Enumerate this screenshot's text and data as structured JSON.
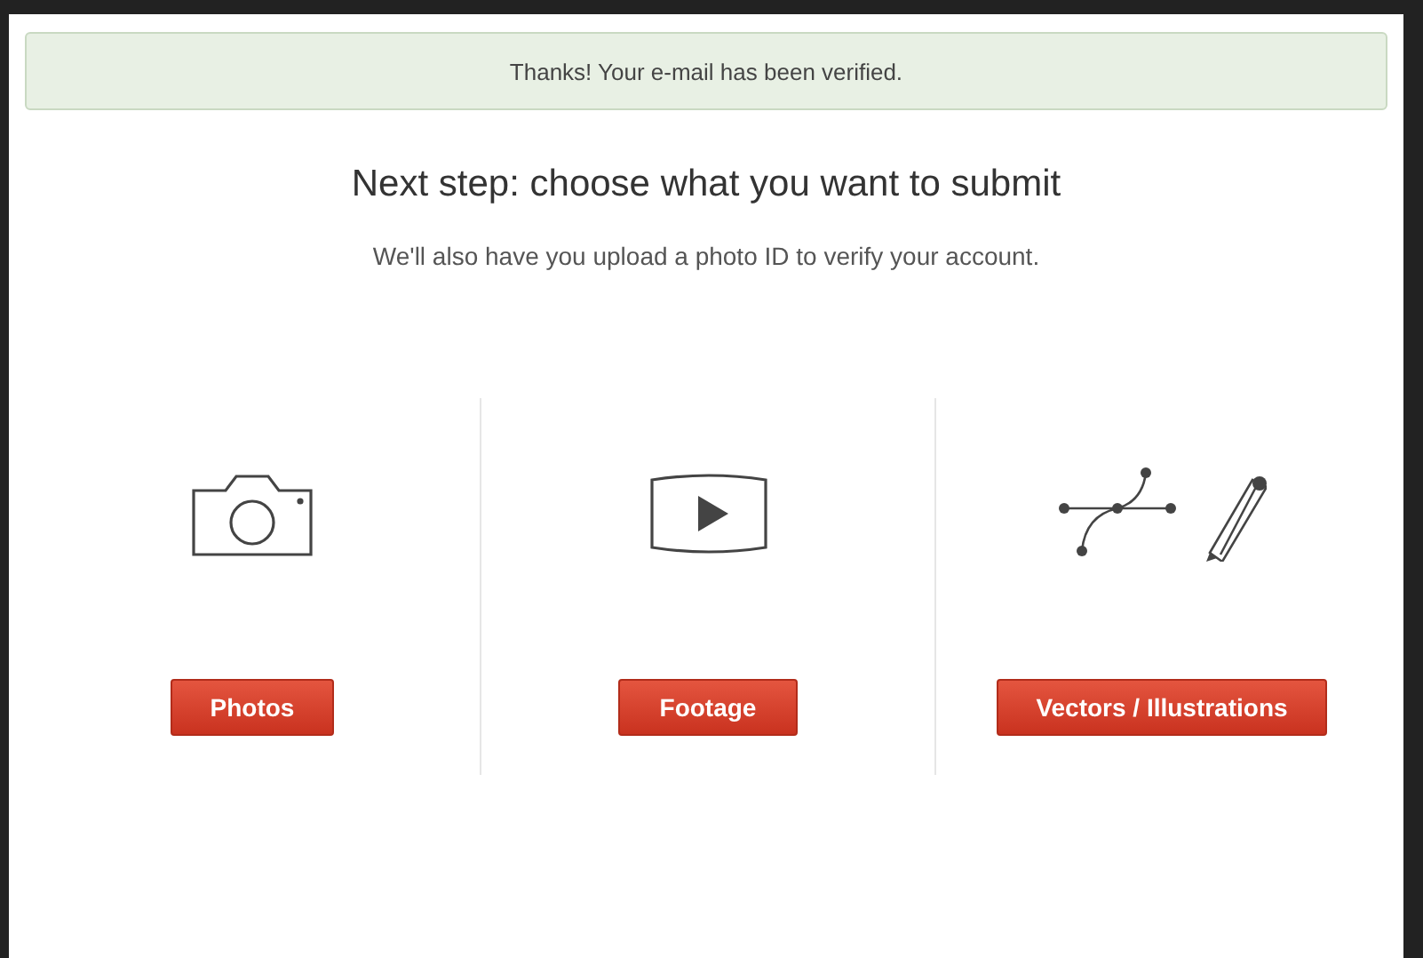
{
  "notice": {
    "text": "Thanks! Your e-mail has been verified."
  },
  "heading": "Next step: choose what you want to submit",
  "subtitle": "We'll also have you upload a photo ID to verify your account.",
  "options": [
    {
      "kind": "camera",
      "label": "Photos"
    },
    {
      "kind": "video",
      "label": "Footage"
    },
    {
      "kind": "vector",
      "label": "Vectors / Illustrations"
    }
  ]
}
